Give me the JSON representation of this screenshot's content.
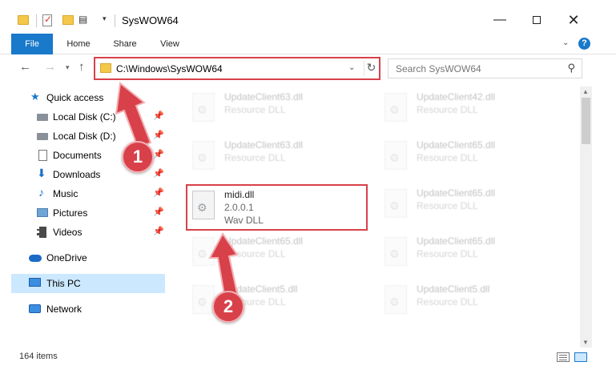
{
  "window": {
    "title": "SysWOW64",
    "minimize_glyph": "—",
    "maximize_glyph": "",
    "close_glyph": "✕"
  },
  "quick_access_toolbar": {
    "customize_glyph": "▤",
    "dropdown_glyph": "▾"
  },
  "ribbon": {
    "tabs": [
      {
        "label": "File"
      },
      {
        "label": "Home"
      },
      {
        "label": "Share"
      },
      {
        "label": "View"
      }
    ],
    "expand_glyph": "⌄",
    "help_glyph": "?"
  },
  "nav": {
    "back_glyph": "←",
    "forward_glyph": "→",
    "recent_glyph": "▾",
    "up_glyph": "↑"
  },
  "address": {
    "path": "C:\\Windows\\SysWOW64",
    "dropdown_glyph": "⌄",
    "refresh_glyph": "↻"
  },
  "search": {
    "placeholder": "Search SysWOW64",
    "icon_glyph": "⚲"
  },
  "sidebar": {
    "items": [
      {
        "label": "Quick access",
        "icon": "star-icon",
        "pinned": false
      },
      {
        "label": "Local Disk (C:)",
        "icon": "drive-icon",
        "pinned": true
      },
      {
        "label": "Local Disk (D:)",
        "icon": "drive-icon",
        "pinned": true
      },
      {
        "label": "Documents",
        "icon": "documents-icon",
        "pinned": true
      },
      {
        "label": "Downloads",
        "icon": "downloads-icon",
        "pinned": true
      },
      {
        "label": "Music",
        "icon": "music-icon",
        "pinned": true
      },
      {
        "label": "Pictures",
        "icon": "pictures-icon",
        "pinned": true
      },
      {
        "label": "Videos",
        "icon": "videos-icon",
        "pinned": true
      },
      {
        "label": "OneDrive",
        "icon": "onedrive-icon",
        "pinned": false
      },
      {
        "label": "This PC",
        "icon": "this-pc-icon",
        "pinned": false,
        "selected": true
      },
      {
        "label": "Network",
        "icon": "network-icon",
        "pinned": false
      }
    ],
    "pin_glyph": "📌",
    "star_glyph": "★",
    "download_glyph": "⬇",
    "music_glyph": "♪"
  },
  "files": {
    "left_column": [
      {
        "name": "UpdateClient63.dll",
        "type": "Resource DLL",
        "faded": true
      },
      {
        "name": "UpdateClient63.dll",
        "type": "Resource DLL",
        "faded": true
      },
      {
        "name": "midi.dll",
        "version": "2.0.0.1",
        "type": "Wav DLL",
        "faded": false
      },
      {
        "name": "UpdateClient65.dll",
        "type": "Resource DLL",
        "faded": true
      },
      {
        "name": "UpdateClient5.dll",
        "type": "Resource DLL",
        "faded": true
      }
    ],
    "right_column": [
      {
        "name": "UpdateClient42.dll",
        "type": "Resource DLL",
        "faded": true
      },
      {
        "name": "UpdateClient65.dll",
        "type": "Resource DLL",
        "faded": true
      },
      {
        "name": "UpdateClient65.dll",
        "type": "Resource DLL",
        "faded": true
      },
      {
        "name": "UpdateClient65.dll",
        "type": "Resource DLL",
        "faded": true
      },
      {
        "name": "UpdateClient5.dll",
        "type": "Resource DLL",
        "faded": true
      }
    ]
  },
  "scrollbar": {
    "up_glyph": "▲",
    "down_glyph": "▼"
  },
  "status": {
    "item_count": "164 items"
  },
  "annotations": {
    "marker_1": "1",
    "marker_2": "2",
    "color": "#d8414a"
  },
  "colors": {
    "accent": "#1979ca",
    "selection": "#cce8ff",
    "highlight": "#d8414a"
  }
}
